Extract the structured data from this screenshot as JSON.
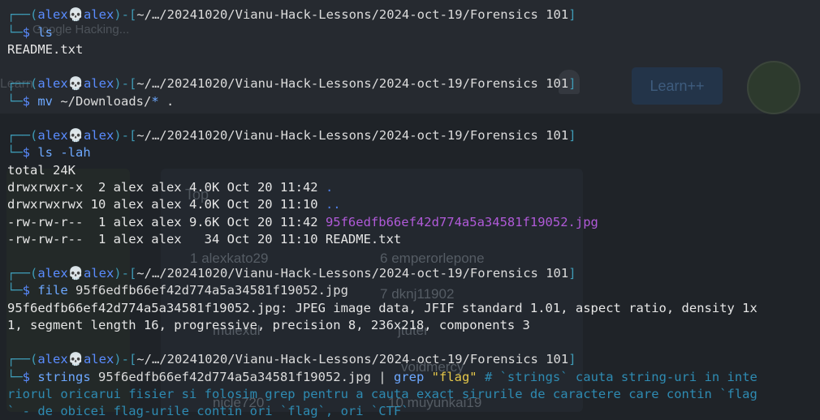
{
  "background": {
    "search_placeholder": "Google Hacking...",
    "logo_text": "Learn",
    "learn_button": "Learn++",
    "leaderboard_title": "Top",
    "ranks": [
      {
        "n": "1",
        "name": "alexkato29"
      },
      {
        "n": "6",
        "name": "emperorlepone"
      },
      {
        "n": "7",
        "name": "dknj11902"
      },
      {
        "n": "",
        "name": "mulexul"
      },
      {
        "n": "",
        "name": "jtuter"
      },
      {
        "n": "",
        "name": "voidmercy"
      },
      {
        "n": "",
        "name": "nicle720"
      },
      {
        "n": "10",
        "name": "muyunkai19"
      }
    ]
  },
  "prompt": {
    "open": "┌──(",
    "user": "alex",
    "skull": "💀",
    "host": "alex",
    "mid": ")-[",
    "path": "~/…/20241020/Vianu-Hack-Lessons/2024-oct-19/Forensics 101",
    "close": "]",
    "arrow": "└─",
    "dollar": "$ "
  },
  "blocks": [
    {
      "cmd": "ls",
      "args": "",
      "output": [
        "README.txt"
      ]
    },
    {
      "cmd": "mv",
      "args": " ~/Downloads/",
      "glob": "*",
      "tail": " ."
    },
    {
      "cmd": "ls",
      "args": " -lah",
      "listing": [
        {
          "text": "total 24K",
          "name": ""
        },
        {
          "text": "drwxrwxr-x  2 alex alex 4.0K Oct 20 11:42 ",
          "name": "."
        },
        {
          "text": "drwxrwxrwx 10 alex alex 4.0K Oct 20 11:10 ",
          "name": ".."
        },
        {
          "text": "-rw-rw-r--  1 alex alex 9.6K Oct 20 11:42 ",
          "name": "95f6edfb66ef42d774a5a34581f19052.jpg"
        },
        {
          "text": "-rw-rw-r--  1 alex alex   34 Oct 20 11:10 README.txt",
          "name": ""
        }
      ]
    },
    {
      "cmd": "file",
      "args": " 95f6edfb66ef42d774a5a34581f19052.jpg",
      "output": [
        "95f6edfb66ef42d774a5a34581f19052.jpg: JPEG image data, JFIF standard 1.01, aspect ratio, density 1x",
        "1, segment length 16, progressive, precision 8, 236x218, components 3"
      ]
    },
    {
      "cmd": "strings",
      "args": " 95f6edfb66ef42d774a5a34581f19052.jpg | ",
      "pipe_cmd": "grep",
      "pattern": " \"flag\"",
      "comment": [
        " # `strings` cauta string-uri in inte",
        "riorul oricarui fisier si folosim grep pentru a cauta exact sirurile de caractere care contin `flag",
        "` - de obicei flag-urile contin ori `flag`, ori `CTF`"
      ]
    }
  ],
  "colors": {
    "bracket": "#3e9ab5",
    "user": "#5a8cff",
    "command": "#6da8ff",
    "directory": "#4f7fe6",
    "image_file": "#b05ad8",
    "string": "#e6c84a",
    "comment": "#2e8bb2"
  }
}
